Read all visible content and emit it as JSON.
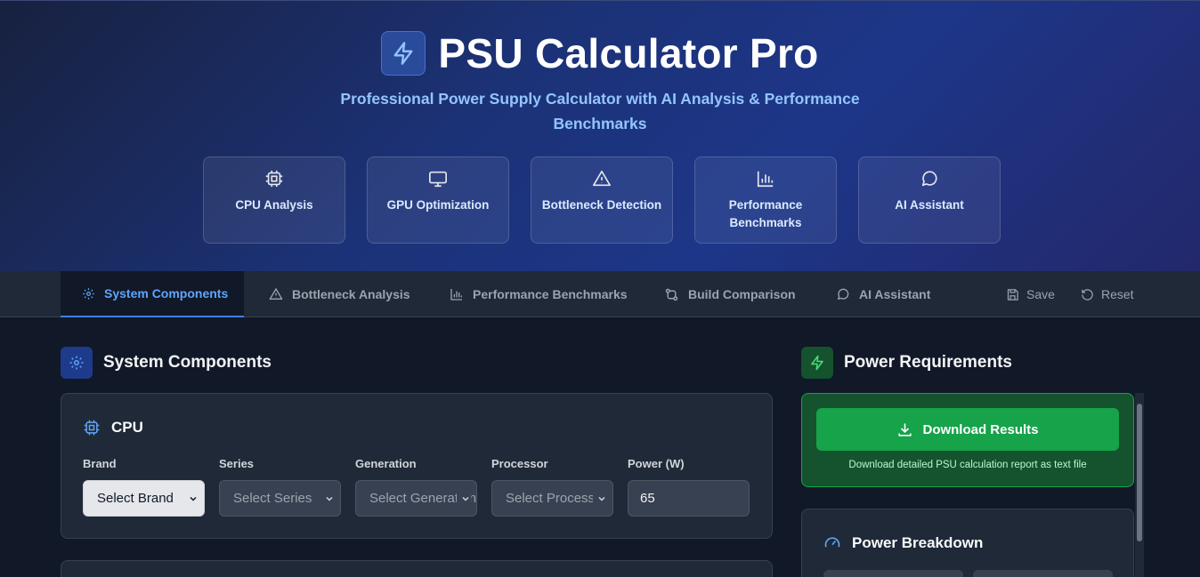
{
  "header": {
    "title": "PSU Calculator Pro",
    "subtitle": "Professional Power Supply Calculator with AI Analysis & Performance Benchmarks",
    "features": [
      {
        "label": "CPU Analysis",
        "icon": "cpu-icon"
      },
      {
        "label": "GPU Optimization",
        "icon": "monitor-icon"
      },
      {
        "label": "Bottleneck Detection",
        "icon": "warning-icon"
      },
      {
        "label": "Performance Benchmarks",
        "icon": "bar-chart-icon"
      },
      {
        "label": "AI Assistant",
        "icon": "chat-icon"
      }
    ]
  },
  "nav": {
    "tabs": [
      {
        "label": "System Components",
        "icon": "gear-icon",
        "active": true
      },
      {
        "label": "Bottleneck Analysis",
        "icon": "warning-icon"
      },
      {
        "label": "Performance Benchmarks",
        "icon": "bar-chart-icon"
      },
      {
        "label": "Build Comparison",
        "icon": "compare-icon"
      },
      {
        "label": "AI Assistant",
        "icon": "chat-icon"
      }
    ],
    "save_label": "Save",
    "reset_label": "Reset"
  },
  "components": {
    "title": "System Components",
    "cpu": {
      "title": "CPU",
      "fields": [
        {
          "label": "Brand",
          "value": "Select Brand"
        },
        {
          "label": "Series",
          "value": "Select Series"
        },
        {
          "label": "Generation",
          "value": "Select Generation"
        },
        {
          "label": "Processor",
          "value": "Select Processor"
        },
        {
          "label": "Power (W)",
          "value": "65"
        }
      ]
    }
  },
  "power": {
    "title": "Power Requirements",
    "download_label": "Download Results",
    "download_note": "Download detailed PSU calculation report as text file",
    "breakdown_title": "Power Breakdown"
  },
  "colors": {
    "accent": "#3b82f6",
    "success": "#16a34a",
    "background": "#111827"
  }
}
